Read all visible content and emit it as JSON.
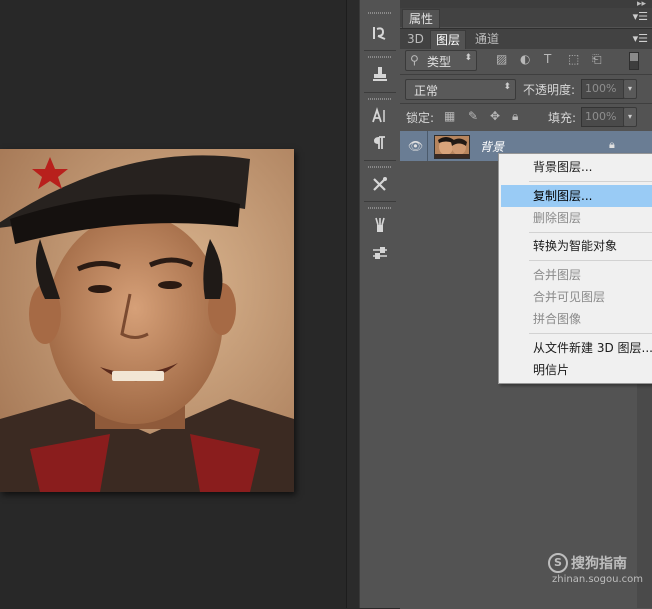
{
  "panel": {
    "properties_tab": "属性",
    "tabs": [
      "3D",
      "图层",
      "通道"
    ],
    "filter_kind": "类型",
    "blend_mode": "正常",
    "opacity_label": "不透明度:",
    "opacity_value": "100%",
    "lock_label": "锁定:",
    "fill_label": "填充:",
    "fill_value": "100%"
  },
  "layer": {
    "name": "背景"
  },
  "context_menu": {
    "items": [
      {
        "label": "背景图层...",
        "state": "enabled"
      },
      {
        "label": "复制图层...",
        "state": "highlighted"
      },
      {
        "label": "删除图层",
        "state": "disabled"
      },
      {
        "label": "转换为智能对象",
        "state": "enabled"
      },
      {
        "label": "合并图层",
        "state": "disabled"
      },
      {
        "label": "合并可见图层",
        "state": "disabled"
      },
      {
        "label": "拼合图像",
        "state": "disabled"
      },
      {
        "label": "从文件新建 3D 图层...",
        "state": "enabled"
      },
      {
        "label": "明信片",
        "state": "enabled"
      }
    ]
  },
  "watermark": {
    "brand": "搜狗指南",
    "url": "zhinan.sogou.com"
  },
  "colors": {
    "highlight": "#99cbf5",
    "selected_layer": "#6a7d94",
    "panel_bg": "#535353",
    "canvas_bg": "#282828"
  },
  "icons": [
    "history-icon",
    "stamp-icon",
    "character-icon",
    "paragraph-icon",
    "tools-preset-icon",
    "brush-icon",
    "brush-preset-icon",
    "eye-icon",
    "lock-icon",
    "search-icon",
    "panel-menu-icon"
  ]
}
